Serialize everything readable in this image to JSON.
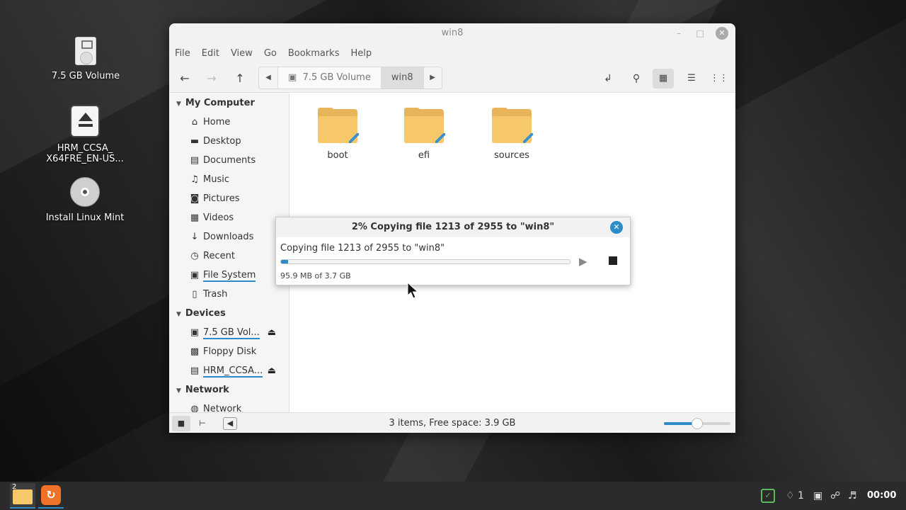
{
  "desktop": {
    "icons": [
      {
        "label": "7.5 GB Volume"
      },
      {
        "label": "HRM_CCSA_ X64FRE_EN-US..."
      },
      {
        "label": "Install Linux Mint"
      }
    ]
  },
  "window": {
    "title": "win8",
    "menu": [
      "File",
      "Edit",
      "View",
      "Go",
      "Bookmarks",
      "Help"
    ],
    "path": {
      "crumbs": [
        "7.5 GB Volume",
        "win8"
      ]
    },
    "sidebar": {
      "sections": [
        {
          "title": "My Computer",
          "items": [
            {
              "label": "Home",
              "icon": "home-icon",
              "glyph": "⌂"
            },
            {
              "label": "Desktop",
              "icon": "desktop-icon",
              "glyph": "▬"
            },
            {
              "label": "Documents",
              "icon": "documents-icon",
              "glyph": "▤"
            },
            {
              "label": "Music",
              "icon": "music-icon",
              "glyph": "♫"
            },
            {
              "label": "Pictures",
              "icon": "camera-icon",
              "glyph": "◙"
            },
            {
              "label": "Videos",
              "icon": "film-icon",
              "glyph": "▦"
            },
            {
              "label": "Downloads",
              "icon": "download-icon",
              "glyph": "↓"
            },
            {
              "label": "Recent",
              "icon": "clock-icon",
              "glyph": "◷"
            },
            {
              "label": "File System",
              "icon": "filesystem-icon",
              "glyph": "▣"
            },
            {
              "label": "Trash",
              "icon": "trash-icon",
              "glyph": "▯"
            }
          ]
        },
        {
          "title": "Devices",
          "items": [
            {
              "label": "7.5 GB Vol...",
              "icon": "usb-drive-icon",
              "glyph": "▣"
            },
            {
              "label": "Floppy Disk",
              "icon": "floppy-icon",
              "glyph": "▩"
            },
            {
              "label": "HRM_CCSA...",
              "icon": "optical-drive-icon",
              "glyph": "▤"
            }
          ]
        },
        {
          "title": "Network",
          "items": [
            {
              "label": "Network",
              "icon": "network-icon",
              "glyph": "◍"
            }
          ]
        }
      ]
    },
    "folders": [
      {
        "label": "boot"
      },
      {
        "label": "efi"
      },
      {
        "label": "sources"
      }
    ],
    "status": "3 items, Free space: 3.9 GB",
    "zoom_fraction": 0.5
  },
  "dialog": {
    "title": "2% Copying file 1213 of 2955 to \"win8\"",
    "message": "Copying file 1213 of 2955 to \"win8\"",
    "detail": "95.9 MB of 3.7 GB",
    "progress": 0.025
  },
  "taskbar": {
    "files_badge": "2",
    "notifications_count": "1",
    "clock": "00:00"
  }
}
